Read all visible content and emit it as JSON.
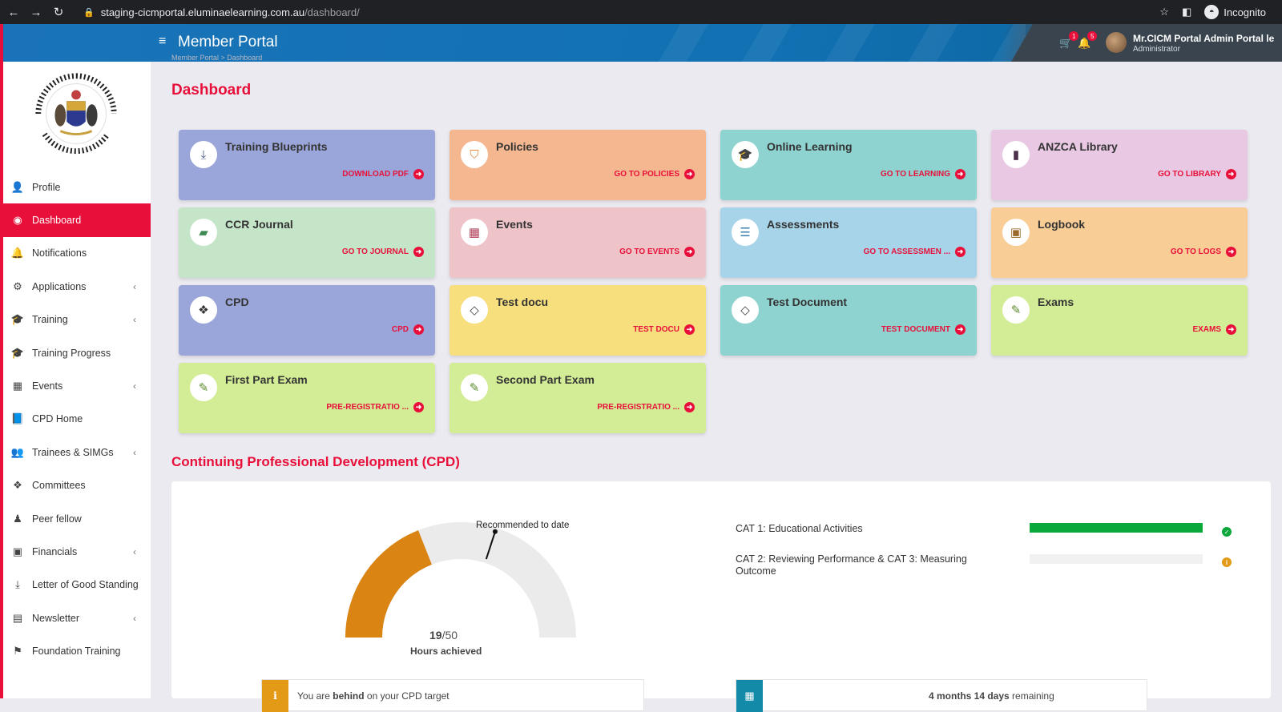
{
  "browser": {
    "url_host": "staging-cicmportal.eluminaelearning.com.au",
    "url_path": "/dashboard/",
    "mode_label": "Incognito"
  },
  "header": {
    "title": "Member Portal",
    "cart_count": "1",
    "notification_count": "5",
    "user_name": "Mr.CICM Portal Admin Portal le",
    "user_role": "Administrator"
  },
  "breadcrumb": "Member Portal  >  Dashboard",
  "sidebar": {
    "items": [
      {
        "label": "Profile",
        "icon": "user-icon"
      },
      {
        "label": "Dashboard",
        "icon": "dashboard-icon"
      },
      {
        "label": "Notifications",
        "icon": "bell-icon"
      },
      {
        "label": "Applications",
        "icon": "gear-icon"
      },
      {
        "label": "Training",
        "icon": "graduation-cap-icon"
      },
      {
        "label": "Training Progress",
        "icon": "graduation-cap-icon"
      },
      {
        "label": "Events",
        "icon": "calendar-icon"
      },
      {
        "label": "CPD Home",
        "icon": "book-icon"
      },
      {
        "label": "Trainees & SIMGs",
        "icon": "users-icon"
      },
      {
        "label": "Committees",
        "icon": "cubes-icon"
      },
      {
        "label": "Peer fellow",
        "icon": "user-tie-icon"
      },
      {
        "label": "Financials",
        "icon": "money-icon"
      },
      {
        "label": "Letter of Good Standing",
        "icon": "download-icon"
      },
      {
        "label": "Newsletter",
        "icon": "newspaper-icon"
      },
      {
        "label": "Foundation Training",
        "icon": "flag-icon"
      }
    ]
  },
  "page_title": "Dashboard",
  "cards": [
    {
      "title": "Training Blueprints",
      "link": "DOWNLOAD PDF",
      "icon": "download-icon",
      "color": "#9aa6d9"
    },
    {
      "title": "Policies",
      "link": "GO TO POLICIES",
      "icon": "shield-icon",
      "color": "#f4b78f"
    },
    {
      "title": "Online Learning",
      "link": "GO TO LEARNING",
      "icon": "graduation-cap-icon",
      "color": "#8fd3d0"
    },
    {
      "title": "ANZCA Library",
      "link": "GO TO LIBRARY",
      "icon": "file-icon",
      "color": "#e8c8e2"
    },
    {
      "title": "CCR Journal",
      "link": "GO TO JOURNAL",
      "icon": "journal-icon",
      "color": "#c4e5c8"
    },
    {
      "title": "Events",
      "link": "GO TO EVENTS",
      "icon": "calendar-check-icon",
      "color": "#efc4c8"
    },
    {
      "title": "Assessments",
      "link": "GO TO ASSESSMEN ...",
      "icon": "list-icon",
      "color": "#a8d4ea"
    },
    {
      "title": "Logbook",
      "link": "GO TO LOGS",
      "icon": "id-badge-icon",
      "color": "#f8cd96"
    },
    {
      "title": "CPD",
      "link": "CPD",
      "icon": "cubes-icon",
      "color": "#9aa6d9"
    },
    {
      "title": "Test docu",
      "link": "TEST DOCU",
      "icon": "diamond-icon",
      "color": "#f7df7e"
    },
    {
      "title": "Test Document",
      "link": "TEST DOCUMENT",
      "icon": "diamond-icon",
      "color": "#8fd3d0"
    },
    {
      "title": "Exams",
      "link": "EXAMS",
      "icon": "edit-icon",
      "color": "#d3ec96"
    },
    {
      "title": "First Part Exam",
      "link": "PRE-REGISTRATIO ...",
      "icon": "edit-icon",
      "color": "#d3ec96"
    },
    {
      "title": "Second Part Exam",
      "link": "PRE-REGISTRATIO ...",
      "icon": "edit-icon",
      "color": "#d3ec96"
    }
  ],
  "cpd": {
    "title": "Continuing Professional Development (CPD)",
    "gauge": {
      "achieved": 19,
      "target": 50,
      "achieved_text": "19",
      "target_text": "/50",
      "label": "Hours achieved",
      "marker_label": "Recommended to date",
      "fill_color": "#d98413",
      "track_color": "#ebebeb"
    },
    "categories": [
      {
        "label": "CAT 1: Educational Activities",
        "progress": 1.0,
        "status": "complete"
      },
      {
        "label": "CAT 2: Reviewing Performance & CAT 3: Measuring Outcome",
        "progress": 0.0,
        "status": "warning"
      }
    ],
    "status_message": {
      "pre": "You are ",
      "strong": "behind",
      "post": " on your CPD target"
    },
    "time_message": {
      "strong": "4 months 14 days",
      "post": " remaining"
    }
  }
}
